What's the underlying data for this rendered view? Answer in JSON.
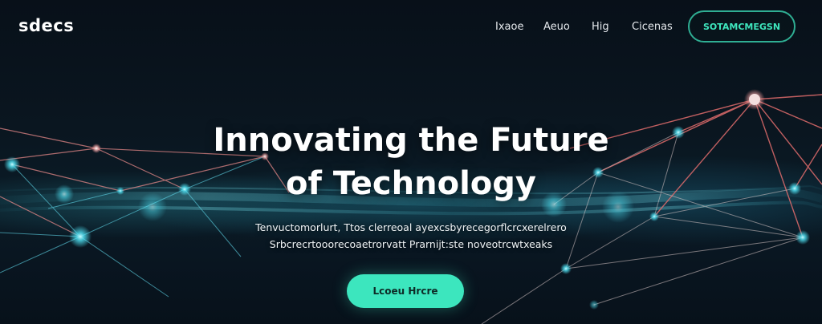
{
  "header": {
    "logo": "sdecs",
    "nav": [
      "Ixaoe",
      "Aeuo",
      "Hig",
      "Cicenas"
    ],
    "cta_label": "SOTAMCMEGSN"
  },
  "hero": {
    "title_line1": "Innovating the Future",
    "title_line2": "of Technology",
    "subtitle_line1": "Tenvuctomorlurt, Ttos clerreoal ayexcsbyrecegorflcrcxerelrero",
    "subtitle_line2": "Srbcrecrtooorecoaetrorvatt Prarnijt:ste noveotrcwtxeaks",
    "cta_label": "Lcoeu Hrcre"
  },
  "colors": {
    "accent": "#3ce6be",
    "accent_border": "#2fae93",
    "background": "#081019",
    "node_cyan": "#4fe3f5",
    "node_red": "#f08a8a"
  },
  "icons": {
    "network": "network-graph-background"
  }
}
